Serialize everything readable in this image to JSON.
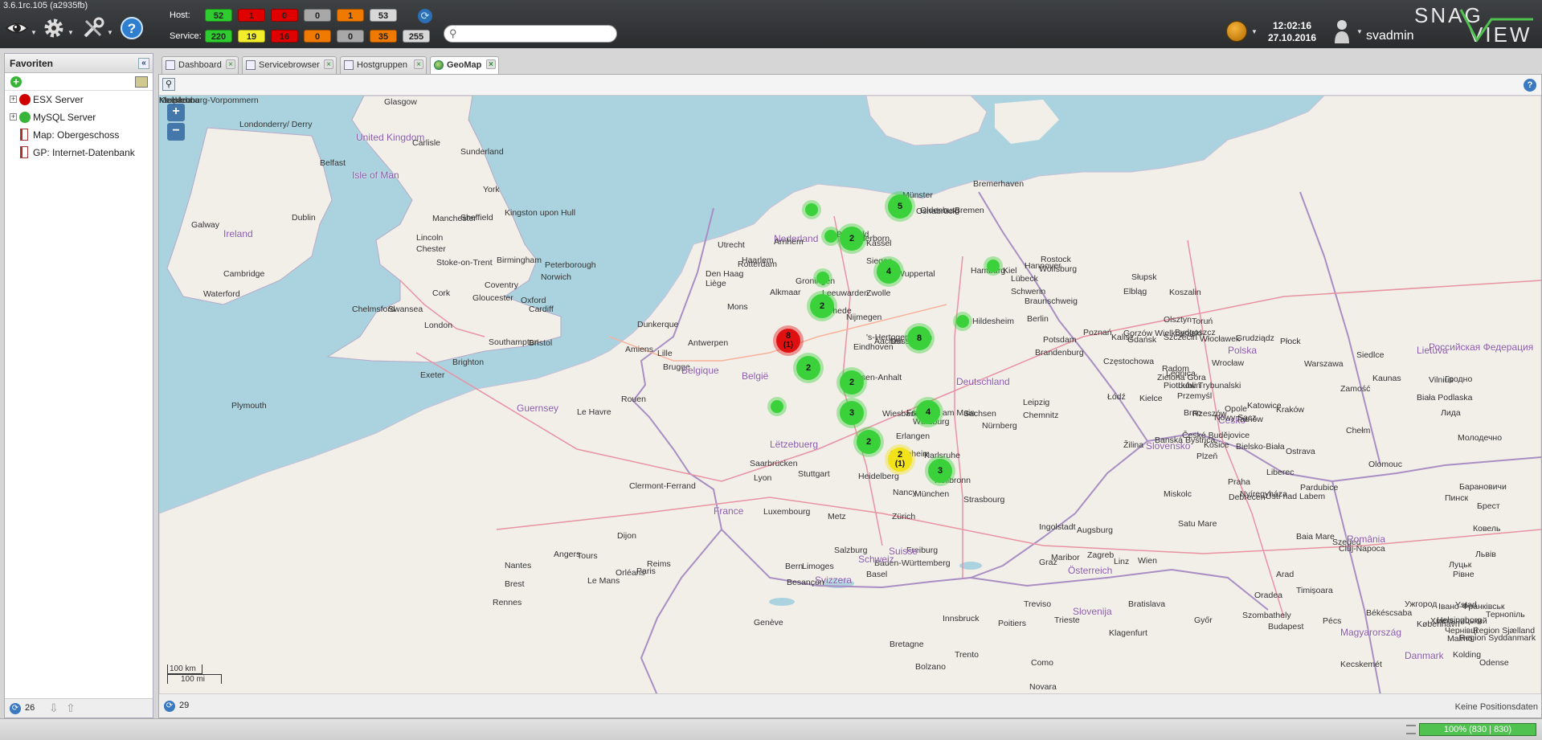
{
  "app": {
    "version": "3.6.1rc.105 (a2935fb)",
    "clock_time": "12:02:16",
    "clock_date": "27.10.2016",
    "username": "svadmin",
    "logo_text": "SNAG VIEW"
  },
  "toolbar": {
    "icons": [
      "eye-icon",
      "gear-icon",
      "tools-icon",
      "help-icon"
    ]
  },
  "counters": {
    "host_label": "Host:",
    "service_label": "Service:",
    "host": [
      {
        "value": "52",
        "color": "#2ecc2e"
      },
      {
        "value": "1",
        "color": "#e00000"
      },
      {
        "value": "0",
        "color": "#e00000"
      },
      {
        "value": "0",
        "color": "#a8a8a8"
      },
      {
        "value": "1",
        "color": "#f07a00"
      },
      {
        "value": "53",
        "color": "#d8d8d8"
      }
    ],
    "service": [
      {
        "value": "220",
        "color": "#2ecc2e"
      },
      {
        "value": "19",
        "color": "#f3ee2b"
      },
      {
        "value": "16",
        "color": "#e00000"
      },
      {
        "value": "0",
        "color": "#f07a00"
      },
      {
        "value": "0",
        "color": "#a8a8a8"
      },
      {
        "value": "35",
        "color": "#f07a00"
      },
      {
        "value": "255",
        "color": "#d8d8d8"
      }
    ]
  },
  "search": {
    "placeholder": "",
    "value": ""
  },
  "favorites": {
    "title": "Favoriten",
    "items": [
      {
        "label": "ESX Server",
        "type": "host-group",
        "status_color": "#d00000"
      },
      {
        "label": "MySQL Server",
        "type": "host-group",
        "status_color": "#38b438"
      },
      {
        "label": "Map: Obergeschoss",
        "type": "map"
      },
      {
        "label": "GP: Internet-Datenbank",
        "type": "map"
      }
    ],
    "footer_count": "26"
  },
  "tabs": [
    {
      "label": "Dashboard",
      "active": false
    },
    {
      "label": "Servicebrowser",
      "active": false
    },
    {
      "label": "Hostgruppen",
      "active": false
    },
    {
      "label": "GeoMap",
      "active": true
    }
  ],
  "map": {
    "scale_km": "100 km",
    "scale_mi": "100 mi",
    "footer_count": "29",
    "position_status": "Keine Positionsdaten",
    "labels": [
      {
        "text": "Glasgow"
      },
      {
        "text": "Londonderry/ Derry"
      },
      {
        "text": "United Kingdom"
      },
      {
        "text": "Carlisle"
      },
      {
        "text": "Belfast"
      },
      {
        "text": "Isle of Man"
      },
      {
        "text": "Sunderland"
      },
      {
        "text": "York"
      },
      {
        "text": "Dublin"
      },
      {
        "text": "Ireland"
      },
      {
        "text": "Galway"
      },
      {
        "text": "Manchester"
      },
      {
        "text": "Sheffield"
      },
      {
        "text": "Kingston upon Hull"
      },
      {
        "text": "Lincoln"
      },
      {
        "text": "Chester"
      },
      {
        "text": "Stoke-on-Trent"
      },
      {
        "text": "Birmingham"
      },
      {
        "text": "Peterborough"
      },
      {
        "text": "Norwich"
      },
      {
        "text": "Coventry"
      },
      {
        "text": "Cambridge"
      },
      {
        "text": "Waterford"
      },
      {
        "text": "Cork"
      },
      {
        "text": "Gloucester"
      },
      {
        "text": "Oxford"
      },
      {
        "text": "Chelmsford"
      },
      {
        "text": "Swansea"
      },
      {
        "text": "Cardiff"
      },
      {
        "text": "London"
      },
      {
        "text": "Bristol"
      },
      {
        "text": "Southampton"
      },
      {
        "text": "Brighton"
      },
      {
        "text": "Exeter"
      },
      {
        "text": "Plymouth"
      },
      {
        "text": "Guernsey"
      },
      {
        "text": "Le Havre"
      },
      {
        "text": "Rouen"
      },
      {
        "text": "Amiens"
      },
      {
        "text": "Lille"
      },
      {
        "text": "Dunkerque"
      },
      {
        "text": "Brugge"
      },
      {
        "text": "Antwerpen"
      },
      {
        "text": "Belgique"
      },
      {
        "text": "België"
      },
      {
        "text": "Mons"
      },
      {
        "text": "Liège"
      },
      {
        "text": "Rotterdam"
      },
      {
        "text": "Den Haag"
      },
      {
        "text": "Utrecht"
      },
      {
        "text": "Haarlem"
      },
      {
        "text": "Alkmaar"
      },
      {
        "text": "Nederland"
      },
      {
        "text": "Arnhem"
      },
      {
        "text": "Groningen"
      },
      {
        "text": "Leeuwarden"
      },
      {
        "text": "Zwolle"
      },
      {
        "text": "Enschede"
      },
      {
        "text": "Nijmegen"
      },
      {
        "text": "'s-Hertogenbosch"
      },
      {
        "text": "Eindhoven"
      },
      {
        "text": "Aachen"
      },
      {
        "text": "Düsseldorf"
      },
      {
        "text": "Wuppertal"
      },
      {
        "text": "Siegen"
      },
      {
        "text": "Bielefeld"
      },
      {
        "text": "Paderborn"
      },
      {
        "text": "Kassel"
      },
      {
        "text": "Osnabrück"
      },
      {
        "text": "Münster"
      },
      {
        "text": "Oldenburg"
      },
      {
        "text": "Bremen"
      },
      {
        "text": "Bremerhaven"
      },
      {
        "text": "Hamburg"
      },
      {
        "text": "Kiel"
      },
      {
        "text": "Lübeck"
      },
      {
        "text": "Schwerin"
      },
      {
        "text": "Rostock"
      },
      {
        "text": "Hannover"
      },
      {
        "text": "Wolfsburg"
      },
      {
        "text": "Braunschweig"
      },
      {
        "text": "Hildesheim"
      },
      {
        "text": "Berlin"
      },
      {
        "text": "Potsdam"
      },
      {
        "text": "Brandenburg"
      },
      {
        "text": "Sachsen-Anhalt"
      },
      {
        "text": "Deutschland"
      },
      {
        "text": "Leipzig"
      },
      {
        "text": "Chemnitz"
      },
      {
        "text": "Sachsen"
      },
      {
        "text": "Frankfurt am Main"
      },
      {
        "text": "Wiesbaden"
      },
      {
        "text": "Würzburg"
      },
      {
        "text": "Erlangen"
      },
      {
        "text": "Nürnberg"
      },
      {
        "text": "Mannheim"
      },
      {
        "text": "Heidelberg"
      },
      {
        "text": "Karlsruhe"
      },
      {
        "text": "Heilbronn"
      },
      {
        "text": "Stuttgart"
      },
      {
        "text": "Saarbrücken"
      },
      {
        "text": "Luxembourg"
      },
      {
        "text": "Lëtzebuerg"
      },
      {
        "text": "Metz"
      },
      {
        "text": "Nancy"
      },
      {
        "text": "Strasbourg"
      },
      {
        "text": "Ingolstadt"
      },
      {
        "text": "Augsburg"
      },
      {
        "text": "München"
      },
      {
        "text": "Salzburg"
      },
      {
        "text": "Freiburg"
      },
      {
        "text": "Baden-Württemberg"
      },
      {
        "text": "Basel"
      },
      {
        "text": "Zürich"
      },
      {
        "text": "Schweiz"
      },
      {
        "text": "Suisse"
      },
      {
        "text": "Svizzera"
      },
      {
        "text": "Bern"
      },
      {
        "text": "Besançon"
      },
      {
        "text": "Genève"
      },
      {
        "text": "Lyon"
      },
      {
        "text": "Limoges"
      },
      {
        "text": "Clermont-Ferrand"
      },
      {
        "text": "Dijon"
      },
      {
        "text": "France"
      },
      {
        "text": "Paris"
      },
      {
        "text": "Reims"
      },
      {
        "text": "Orléans"
      },
      {
        "text": "Tours"
      },
      {
        "text": "Angers"
      },
      {
        "text": "Le Mans"
      },
      {
        "text": "Rennes"
      },
      {
        "text": "Brest"
      },
      {
        "text": "Nantes"
      },
      {
        "text": "Poitiers"
      },
      {
        "text": "Bretagne"
      },
      {
        "text": "Innsbruck"
      },
      {
        "text": "Bolzano"
      },
      {
        "text": "Trento"
      },
      {
        "text": "Como"
      },
      {
        "text": "Novara"
      },
      {
        "text": "Treviso"
      },
      {
        "text": "Trieste"
      },
      {
        "text": "Slovenija"
      },
      {
        "text": "Klagenfurt"
      },
      {
        "text": "Graz"
      },
      {
        "text": "Maribor"
      },
      {
        "text": "Zagreb"
      },
      {
        "text": "Österreich"
      },
      {
        "text": "Wien"
      },
      {
        "text": "Linz"
      },
      {
        "text": "Bratislava"
      },
      {
        "text": "Győr"
      },
      {
        "text": "Szombathely"
      },
      {
        "text": "Budapest"
      },
      {
        "text": "Magyarország"
      },
      {
        "text": "Pécs"
      },
      {
        "text": "Kecskemét"
      },
      {
        "text": "Békéscsaba"
      },
      {
        "text": "Szeged"
      },
      {
        "text": "Cluj-Napoca"
      },
      {
        "text": "Oradea"
      },
      {
        "text": "Arad"
      },
      {
        "text": "Timișoara"
      },
      {
        "text": "România"
      },
      {
        "text": "Baia Mare"
      },
      {
        "text": "Satu Mare"
      },
      {
        "text": "Miskolc"
      },
      {
        "text": "Nyíregyháza"
      },
      {
        "text": "Debrecen"
      },
      {
        "text": "Košice"
      },
      {
        "text": "Slovensko"
      },
      {
        "text": "Žilina"
      },
      {
        "text": "Banská Bystrica"
      },
      {
        "text": "Brno"
      },
      {
        "text": "Česko"
      },
      {
        "text": "České Budějovice"
      },
      {
        "text": "Plzeň"
      },
      {
        "text": "Praha"
      },
      {
        "text": "Ústí nad Labem"
      },
      {
        "text": "Liberec"
      },
      {
        "text": "Pardubice"
      },
      {
        "text": "Olomouc"
      },
      {
        "text": "Ostrava"
      },
      {
        "text": "Bielsko-Biała"
      },
      {
        "text": "Kraków"
      },
      {
        "text": "Katowice"
      },
      {
        "text": "Opole"
      },
      {
        "text": "Tarnów"
      },
      {
        "text": "Nowy Sącz"
      },
      {
        "text": "Rzeszów"
      },
      {
        "text": "Przemyśl"
      },
      {
        "text": "Lublin"
      },
      {
        "text": "Kielce"
      },
      {
        "text": "Radom"
      },
      {
        "text": "Łódź"
      },
      {
        "text": "Częstochowa"
      },
      {
        "text": "Piotrków Trybunalski"
      },
      {
        "text": "Wrocław"
      },
      {
        "text": "Legnica"
      },
      {
        "text": "Zielona Góra"
      },
      {
        "text": "Kalisz"
      },
      {
        "text": "Poznań"
      },
      {
        "text": "Gorzów Wielkopolski"
      },
      {
        "text": "Szczecin"
      },
      {
        "text": "Koszalin"
      },
      {
        "text": "Słupsk"
      },
      {
        "text": "Gdańsk"
      },
      {
        "text": "Elbląg"
      },
      {
        "text": "Olsztyn"
      },
      {
        "text": "Bydgoszcz"
      },
      {
        "text": "Toruń"
      },
      {
        "text": "Grudziądz"
      },
      {
        "text": "Płock"
      },
      {
        "text": "Włocławek"
      },
      {
        "text": "Polska"
      },
      {
        "text": "Warszawa"
      },
      {
        "text": "Siedlce"
      },
      {
        "text": "Biała Podlaska"
      },
      {
        "text": "Chełm"
      },
      {
        "text": "Zamość"
      },
      {
        "text": "Kaunas"
      },
      {
        "text": "Vilnius"
      },
      {
        "text": "Lietuva"
      },
      {
        "text": "Российская Федерация"
      },
      {
        "text": "Гродно"
      },
      {
        "text": "Лида"
      },
      {
        "text": "Молодечно"
      },
      {
        "text": "Барановичи"
      },
      {
        "text": "Пинск"
      },
      {
        "text": "Брест"
      },
      {
        "text": "Ковель"
      },
      {
        "text": "Луцьк"
      },
      {
        "text": "Рівне"
      },
      {
        "text": "Львів"
      },
      {
        "text": "Тернопіль"
      },
      {
        "text": "Івано-Франківськ"
      },
      {
        "text": "Ужгород"
      },
      {
        "text": "Хмельницький"
      },
      {
        "text": "Чернівці"
      },
      {
        "text": "Kolding"
      },
      {
        "text": "Odense"
      },
      {
        "text": "København"
      },
      {
        "text": "Danmark"
      },
      {
        "text": "Helsingborg"
      },
      {
        "text": "Malmö"
      },
      {
        "text": "Region Syddanmark"
      },
      {
        "text": "Region Sjælland"
      },
      {
        "text": "Ystad"
      },
      {
        "text": "Karlskrona"
      },
      {
        "text": "Mecklenburg-Vorpommern"
      },
      {
        "text": "Klaipėda"
      }
    ]
  },
  "clusters": [
    {
      "count": "5",
      "sub": "",
      "color": "#3bd13b",
      "size": "large"
    },
    {
      "count": "",
      "sub": "",
      "color": "#3bd13b",
      "size": "small"
    },
    {
      "count": "",
      "sub": "",
      "color": "#3bd13b",
      "size": "small"
    },
    {
      "count": "2",
      "sub": "",
      "color": "#3bd13b",
      "size": "large"
    },
    {
      "count": "",
      "sub": "",
      "color": "#3bd13b",
      "size": "small"
    },
    {
      "count": "4",
      "sub": "",
      "color": "#3bd13b",
      "size": "large"
    },
    {
      "count": "",
      "sub": "",
      "color": "#3bd13b",
      "size": "small"
    },
    {
      "count": "2",
      "sub": "",
      "color": "#3bd13b",
      "size": "large"
    },
    {
      "count": "8",
      "sub": "(1)",
      "color": "#e01010",
      "size": "large"
    },
    {
      "count": "",
      "sub": "",
      "color": "#3bd13b",
      "size": "small"
    },
    {
      "count": "8",
      "sub": "",
      "color": "#3bd13b",
      "size": "large"
    },
    {
      "count": "2",
      "sub": "",
      "color": "#3bd13b",
      "size": "large"
    },
    {
      "count": "2",
      "sub": "",
      "color": "#3bd13b",
      "size": "large"
    },
    {
      "count": "3",
      "sub": "",
      "color": "#3bd13b",
      "size": "large"
    },
    {
      "count": "",
      "sub": "",
      "color": "#3bd13b",
      "size": "small"
    },
    {
      "count": "4",
      "sub": "",
      "color": "#3bd13b",
      "size": "large"
    },
    {
      "count": "2",
      "sub": "",
      "color": "#3bd13b",
      "size": "large"
    },
    {
      "count": "2",
      "sub": "(1)",
      "color": "#f2e21a",
      "size": "large"
    },
    {
      "count": "3",
      "sub": "",
      "color": "#3bd13b",
      "size": "large"
    }
  ],
  "statusbar": {
    "progress_text": "100% (830 | 830)",
    "progress_fraction": 1.0
  }
}
